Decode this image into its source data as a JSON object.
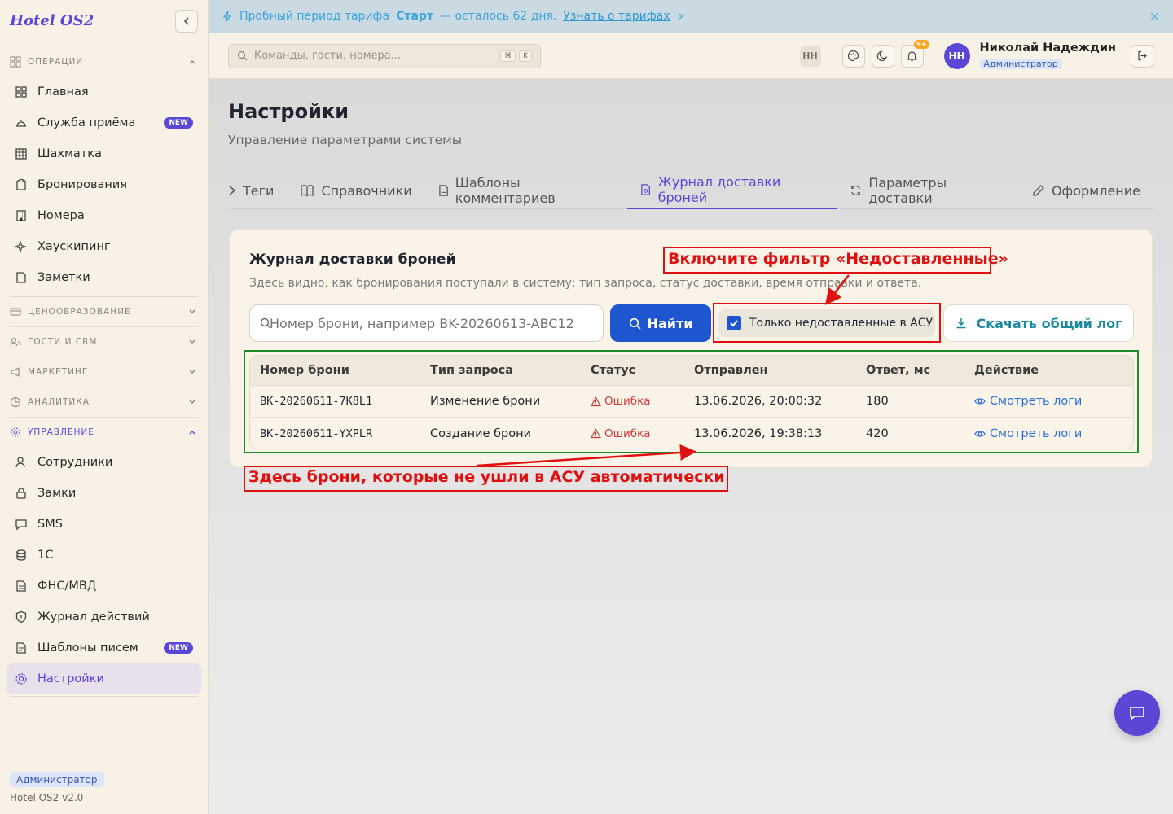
{
  "sidebar": {
    "brand": "Hotel OS2",
    "sections": {
      "operations": "ОПЕРАЦИИ",
      "pricing": "ЦЕНООБРАЗОВАНИЕ",
      "guests": "ГОСТИ И CRM",
      "marketing": "МАРКЕТИНГ",
      "analytics": "АНАЛИТИКА",
      "management": "УПРАВЛЕНИЕ"
    },
    "ops_items": [
      {
        "label": "Главная"
      },
      {
        "label": "Служба приёма",
        "badge": "NEW"
      },
      {
        "label": "Шахматка"
      },
      {
        "label": "Бронирования"
      },
      {
        "label": "Номера"
      },
      {
        "label": "Хаускипинг"
      },
      {
        "label": "Заметки"
      }
    ],
    "mgmt_items": [
      {
        "label": "Сотрудники"
      },
      {
        "label": "Замки"
      },
      {
        "label": "SMS"
      },
      {
        "label": "1С"
      },
      {
        "label": "ФНС/МВД"
      },
      {
        "label": "Журнал действий"
      },
      {
        "label": "Шаблоны писем",
        "badge": "NEW"
      },
      {
        "label": "Настройки"
      }
    ],
    "footer_role": "Администратор",
    "footer_version": "Hotel OS2 v2.0"
  },
  "trial": {
    "text_before": "Пробный период тарифа",
    "plan": "Старт",
    "text_after": "— осталось 62 дня.",
    "link": "Узнать о тарифах",
    "close": "✕"
  },
  "topbar": {
    "search_placeholder": "Команды, гости, номера...",
    "kbd1": "⌘",
    "kbd2": "K",
    "initials_small": "НН",
    "notif_badge": "9+",
    "avatar_initials": "НН",
    "user_name": "Николай Надеждин",
    "user_role": "Администратор"
  },
  "page": {
    "title": "Настройки",
    "subtitle": "Управление параметрами системы",
    "tabs": [
      "Теги",
      "Справочники",
      "Шаблоны комментариев",
      "Журнал доставки броней",
      "Параметры доставки",
      "Оформление"
    ]
  },
  "card": {
    "title": "Журнал доставки броней",
    "subtitle": "Здесь видно, как бронирования поступали в систему: тип запроса, статус доставки, время отправки и ответа.",
    "input_placeholder": "Номер брони, например BK-20260613-ABC12",
    "find_label": "Найти",
    "filter_label": "Только недоставленные в АСУ",
    "filter_checked": true,
    "download_label": "Скачать общий лог"
  },
  "table": {
    "headers": [
      "Номер брони",
      "Тип запроса",
      "Статус",
      "Отправлен",
      "Ответ, мс",
      "Действие"
    ],
    "rows": [
      {
        "id": "BK-20260611-7K8L1",
        "type": "Изменение брони",
        "status": "Ошибка",
        "sent": "13.06.2026, 20:00:32",
        "ms": "180",
        "action": "Смотреть логи"
      },
      {
        "id": "BK-20260611-YXPLR",
        "type": "Создание брони",
        "status": "Ошибка",
        "sent": "13.06.2026, 19:38:13",
        "ms": "420",
        "action": "Смотреть логи"
      }
    ]
  },
  "annotations": {
    "top": "Включите фильтр «Недоставленные»",
    "bottom": "Здесь брони, которые не ушли в АСУ автоматически"
  },
  "colors": {
    "accent": "#5b47d6",
    "primary_button": "#1e56d0",
    "annotation_red": "#e01010",
    "annotation_green": "#1f8a2a",
    "error": "#d03a3a"
  }
}
